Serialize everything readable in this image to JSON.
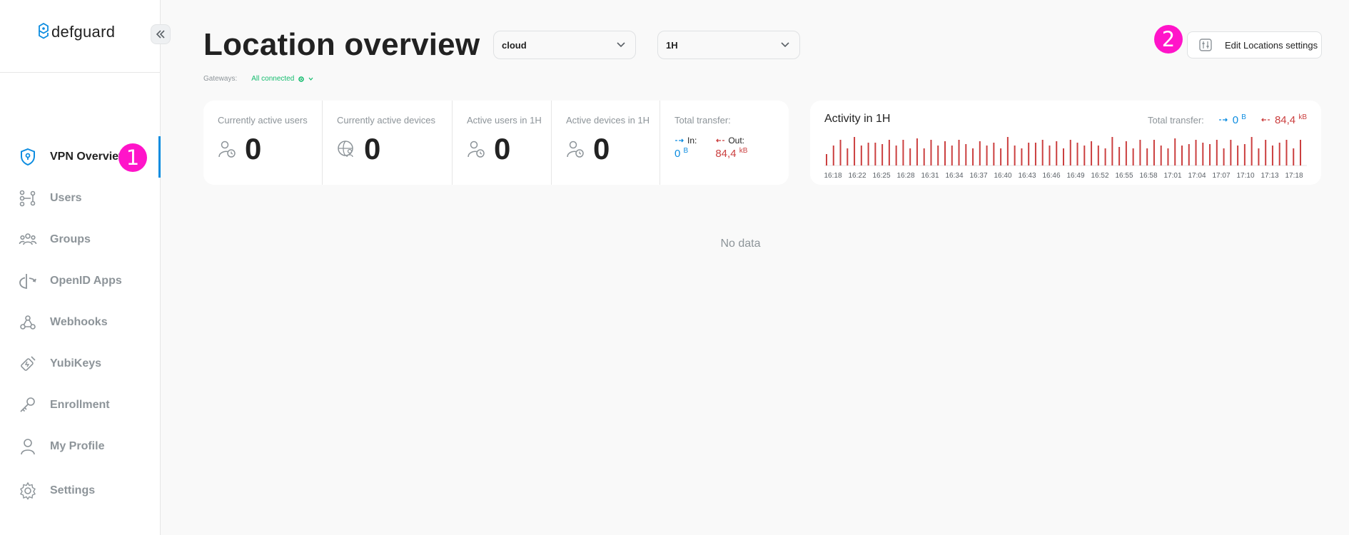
{
  "app": {
    "logo_text": "defguard"
  },
  "sidebar": {
    "items": [
      {
        "label": "VPN Overview",
        "icon": "shield-lock-icon",
        "active": true
      },
      {
        "label": "Users",
        "icon": "users-icon"
      },
      {
        "label": "Groups",
        "icon": "groups-icon"
      },
      {
        "label": "OpenID Apps",
        "icon": "openid-icon"
      },
      {
        "label": "Webhooks",
        "icon": "webhook-icon"
      },
      {
        "label": "YubiKeys",
        "icon": "yubikey-icon"
      },
      {
        "label": "Enrollment",
        "icon": "key-icon"
      },
      {
        "label": "My Profile",
        "icon": "user-icon"
      }
    ],
    "settings_label": "Settings"
  },
  "markers": [
    "1",
    "2"
  ],
  "header": {
    "title": "Location overview",
    "location_select": "cloud",
    "period_select": "1H",
    "gateways_label": "Gateways:",
    "gateways_status": "All connected",
    "edit_button": "Edit Locations settings"
  },
  "stats": {
    "active_users": {
      "label": "Currently active users",
      "value": "0"
    },
    "active_devices": {
      "label": "Currently active devices",
      "value": "0"
    },
    "active_users_1h": {
      "label": "Active users in 1H",
      "value": "0"
    },
    "active_devices_1h": {
      "label": "Active devices in 1H",
      "value": "0"
    },
    "transfer": {
      "label": "Total transfer:",
      "in_label": "In:",
      "in_value": "0",
      "in_unit": "B",
      "out_label": "Out:",
      "out_value": "84,4",
      "out_unit": "kB"
    }
  },
  "activity": {
    "title": "Activity in 1H",
    "transfer_label": "Total transfer:",
    "in_value": "0",
    "in_unit": "B",
    "out_value": "84,4",
    "out_unit": "kB"
  },
  "chart_data": {
    "type": "bar",
    "tick_labels": [
      "16:18",
      "16:22",
      "16:25",
      "16:28",
      "16:31",
      "16:34",
      "16:37",
      "16:40",
      "16:43",
      "16:46",
      "16:49",
      "16:52",
      "16:55",
      "16:58",
      "17:01",
      "17:04",
      "17:07",
      "17:10",
      "17:13",
      "17:18"
    ],
    "series": [
      {
        "name": "Out",
        "color": "#cb3f3f",
        "values": [
          0.4,
          0.7,
          0.9,
          0.6,
          1.0,
          0.7,
          0.8,
          0.8,
          0.75,
          0.9,
          0.7,
          0.9,
          0.6,
          0.95,
          0.6,
          0.9,
          0.7,
          0.85,
          0.7,
          0.9,
          0.75,
          0.6,
          0.85,
          0.7,
          0.8,
          0.6,
          1.0,
          0.7,
          0.6,
          0.8,
          0.8,
          0.9,
          0.7,
          0.85,
          0.6,
          0.9,
          0.8,
          0.7,
          0.85,
          0.7,
          0.6,
          1.0,
          0.65,
          0.85,
          0.6,
          0.9,
          0.6,
          0.9,
          0.7,
          0.6,
          0.95,
          0.7,
          0.75,
          0.9,
          0.8,
          0.75,
          0.9,
          0.6,
          0.9,
          0.7,
          0.75,
          1.0,
          0.6,
          0.9,
          0.7,
          0.8,
          0.9,
          0.6,
          0.9
        ]
      }
    ]
  },
  "main": {
    "empty_text": "No data"
  },
  "colors": {
    "accent": "#0c8ce0",
    "out": "#cb3f3f",
    "ok": "#14bc6e",
    "marker": "#ff14c9"
  }
}
